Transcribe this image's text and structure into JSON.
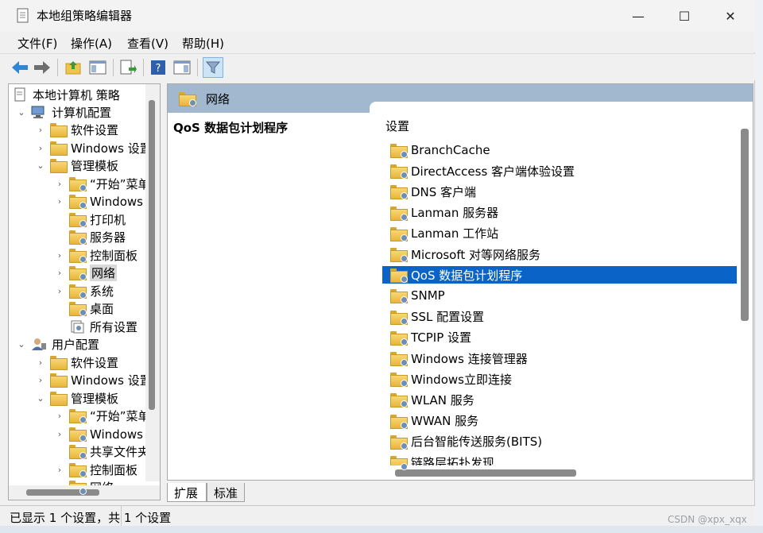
{
  "window": {
    "title": "本地组策略编辑器",
    "controls": {
      "minimize": "—",
      "maximize": "☐",
      "close": "✕"
    }
  },
  "menu": [
    "文件(F)",
    "操作(A)",
    "查看(V)",
    "帮助(H)"
  ],
  "toolbar": {
    "icons": [
      "back-arrow-icon",
      "forward-arrow-icon",
      "up-folder-icon",
      "show-hide-tree-icon",
      "export-list-icon",
      "help-icon",
      "action-pane-icon",
      "filter-icon"
    ]
  },
  "tree": {
    "root": "本地计算机 策略",
    "computer_config": "计算机配置",
    "cc_software": "软件设置",
    "cc_windows": "Windows 设置",
    "cc_admin": "管理模板",
    "cc_start": "“开始”菜单",
    "cc_windows_components": "Windows 组件",
    "cc_printer": "打印机",
    "cc_server": "服务器",
    "cc_control_panel": "控制面板",
    "cc_network": "网络",
    "cc_system": "系统",
    "cc_desktop": "桌面",
    "cc_all_settings": "所有设置",
    "user_config": "用户配置",
    "uc_software": "软件设置",
    "uc_windows": "Windows 设置",
    "uc_admin": "管理模板",
    "uc_start": "“开始”菜单",
    "uc_windows_components": "Windows 组件",
    "uc_shared": "共享文件夹",
    "uc_control_panel": "控制面板",
    "uc_network": "网络"
  },
  "right": {
    "header": "网络",
    "description_title": "QoS 数据包计划程序",
    "column_header": "设置",
    "items": [
      "BranchCache",
      "DirectAccess 客户端体验设置",
      "DNS 客户端",
      "Lanman 服务器",
      "Lanman 工作站",
      "Microsoft 对等网络服务",
      "QoS 数据包计划程序",
      "SNMP",
      "SSL 配置设置",
      "TCPIP 设置",
      "Windows 连接管理器",
      "Windows立即连接",
      "WLAN 服务",
      "WWAN 服务",
      "后台智能传送服务(BITS)",
      "链路层拓扑发现"
    ],
    "selected_index": 6
  },
  "tabs": [
    "扩展",
    "标准"
  ],
  "status": "已显示 1 个设置，共 1 个设置",
  "watermark": "CSDN @xpx_xqx",
  "colors": {
    "selection": "#0a64c8",
    "header_band": "#a2b8cf",
    "folder": "#f0c34a"
  }
}
